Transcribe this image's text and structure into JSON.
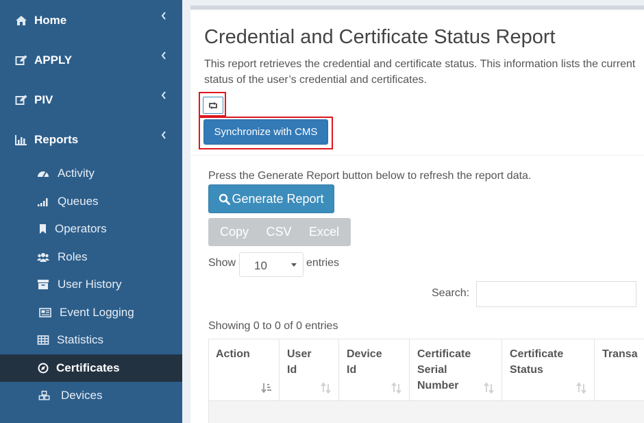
{
  "sidebar": {
    "top_items": [
      {
        "label": "Home",
        "icon": "home-icon"
      },
      {
        "label": "APPLY",
        "icon": "edit-icon"
      },
      {
        "label": "PIV",
        "icon": "edit-icon"
      },
      {
        "label": "Reports",
        "icon": "bar-chart-icon"
      }
    ],
    "sub_items": [
      {
        "label": "Activity",
        "icon": "dashboard-icon"
      },
      {
        "label": "Queues",
        "icon": "signal-icon"
      },
      {
        "label": "Operators",
        "icon": "bookmark-icon"
      },
      {
        "label": "Roles",
        "icon": "users-icon"
      },
      {
        "label": "User History",
        "icon": "archive-icon"
      },
      {
        "label": "Event Logging",
        "icon": "newspaper-icon"
      },
      {
        "label": "Statistics",
        "icon": "table-icon"
      },
      {
        "label": "Certificates",
        "icon": "compass-icon",
        "active": true
      },
      {
        "label": "Devices",
        "icon": "cubes-icon"
      }
    ]
  },
  "main": {
    "title": "Credential and Certificate Status Report",
    "description": "This report retrieves the credential and certificate status. This information lists the current status of the user’s credential and certificates.",
    "sync_label": "Synchronize with CMS",
    "press_text": "Press the Generate Report button below to refresh the report data.",
    "generate_label": "Generate Report",
    "export": [
      "Copy",
      "CSV",
      "Excel"
    ],
    "show_label": "Show",
    "page_length": "10",
    "entries_label": "entries",
    "search_label": "Search:",
    "search_value": "",
    "info": "Showing 0 to 0 of 0 entries",
    "columns": [
      {
        "lines": [
          "Action"
        ]
      },
      {
        "lines": [
          "User",
          "Id"
        ]
      },
      {
        "lines": [
          "Device",
          "Id"
        ]
      },
      {
        "lines": [
          "Certificate",
          "Serial",
          "Number"
        ]
      },
      {
        "lines": [
          "Certificate",
          "Status"
        ]
      },
      {
        "lines": [
          "Transa"
        ]
      }
    ]
  },
  "colors": {
    "sidebar_bg": "#2d5e8a",
    "sidebar_active": "#233241",
    "primary": "#3c8dbc",
    "highlight": "#e0161e"
  }
}
